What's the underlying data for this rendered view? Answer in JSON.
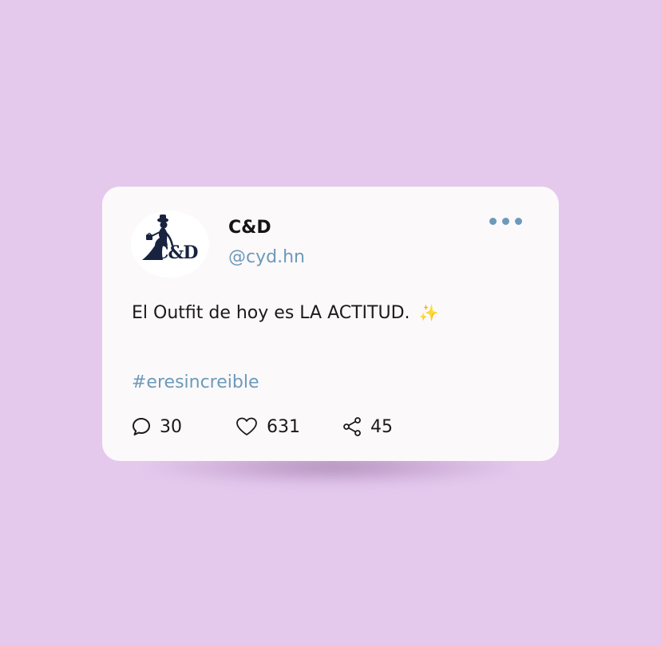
{
  "post": {
    "author_name": "C&D",
    "author_handle": "@cyd.hn",
    "avatar_logo_text": "C&D",
    "text": "El Outfit de hoy es LA ACTITUD.",
    "emoji": "✨",
    "hashtag": "#eresincreible",
    "stats": {
      "replies": "30",
      "likes": "631",
      "shares": "45"
    }
  },
  "icons": {
    "more": "more-dots-icon",
    "reply": "comment-bubble-icon",
    "like": "heart-icon",
    "share": "share-icon"
  },
  "colors": {
    "background": "#e4c9ed",
    "card": "#fcf9fb",
    "accent": "#6c9ab9",
    "text": "#1a1a1a",
    "logo": "#17233f"
  }
}
